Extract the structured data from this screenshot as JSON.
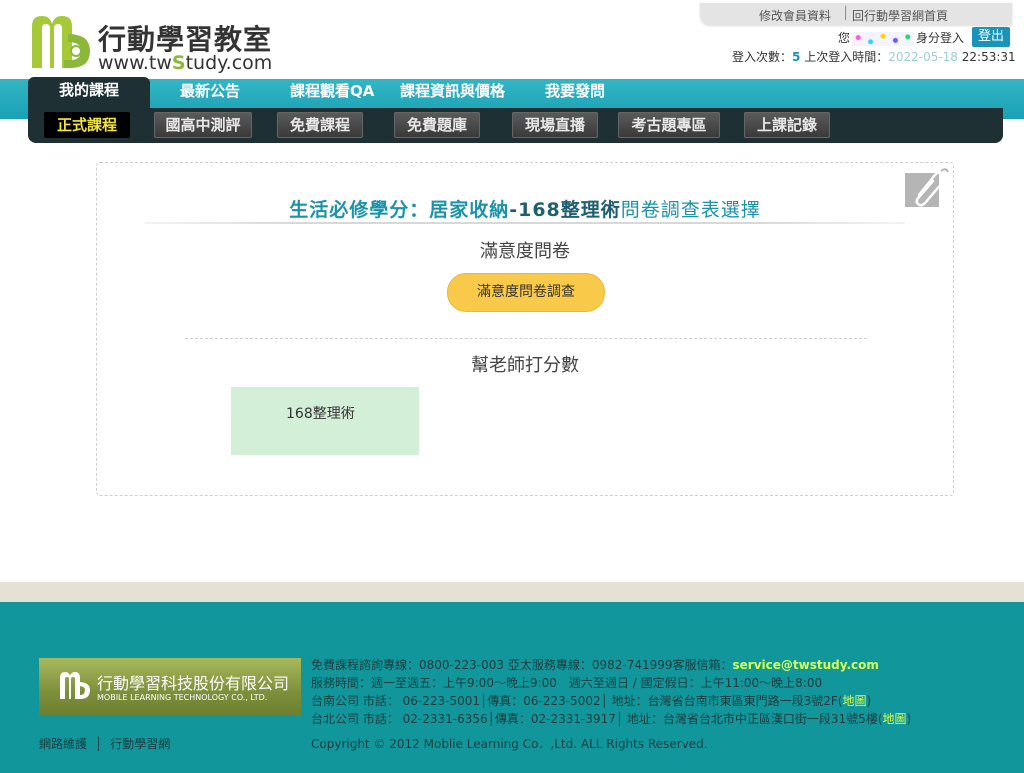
{
  "header": {
    "logo_title": "行動學習教室",
    "logo_url_pre": "www.tw",
    "logo_url_s": "S",
    "logo_url_post": "tudy.com",
    "toplink_1": "修改會員資料",
    "toplink_sep": "│",
    "toplink_2": "回行動學習網首頁",
    "user_prefix": "您",
    "user_suffix": "身分登入",
    "logout": "登出",
    "login_count_label": "登入次數：",
    "login_count": "5",
    "last_login_label": " 上次登入時間：",
    "last_login_date": "2022-05-18",
    "last_login_time": "22:53:31"
  },
  "nav": {
    "tabs": [
      "我的課程",
      "最新公告",
      "課程觀看QA",
      "課程資訊與價格",
      "我要發問"
    ],
    "subtabs": [
      "正式課程",
      "國高中測評",
      "免費課程",
      "免費題庫",
      "現場直播",
      "考古題專區",
      "上課記錄"
    ]
  },
  "main": {
    "title_part1": "生活必修學分：居家收納",
    "title_part2": "-168",
    "title_part3": "整理術",
    "title_part4": "問卷調查表選擇",
    "satisfaction_heading": "滿意度問卷",
    "satisfaction_button": "滿意度問卷調查",
    "rate_heading": "幫老師打分數",
    "course_name": "168整理術"
  },
  "footer": {
    "company_cn": "行動學習科技股份有限公司",
    "company_en": "MOBILE LEARNING TECHNOLOGY CO., LTD.",
    "line1_pre": "免費課程諮詢專線：0800-223-003 亞太服務專線：0982-741999客服信箱：",
    "line1_email": "service@twstudy.com",
    "line2": "服務時間：週一至週五：上午9:00～晚上9:00　週六至週日 / 國定假日：上午11:00～晚上8:00",
    "line3_pre": "台南公司 市話： 06-223-5001│傳真：06-223-5002│ 地址：台灣省台南市東區東門路一段3號2F(",
    "line3_map": "地圖",
    "line3_post": ")",
    "line4_pre": "台北公司 市話： 02-2331-6356│傳真：02-2331-3917│ 地址：台灣省台北市中正區漢口街一段31號5樓(",
    "line4_map": "地圖",
    "line4_post": ")",
    "link_1": "網路維護",
    "link_sep": "│",
    "link_2": "行動學習網",
    "copyright": "Copyright © 2012 Moblie Learning Co．,Ltd. ALL Rights Reserved."
  },
  "colors": {
    "accent_teal": "#1a93b8",
    "nav_teal": "#1aa1b5",
    "nav_dark": "#1f3035",
    "active_subtab_text": "#f2e437",
    "button_yellow": "#f9c94a",
    "course_box_green": "#d4efd8",
    "footer_teal": "#11979b",
    "footer_highlight": "#d8ff4a"
  },
  "icons": [
    "logo-mark-icon",
    "paperclip-icon",
    "footer-logo-mark-icon"
  ]
}
